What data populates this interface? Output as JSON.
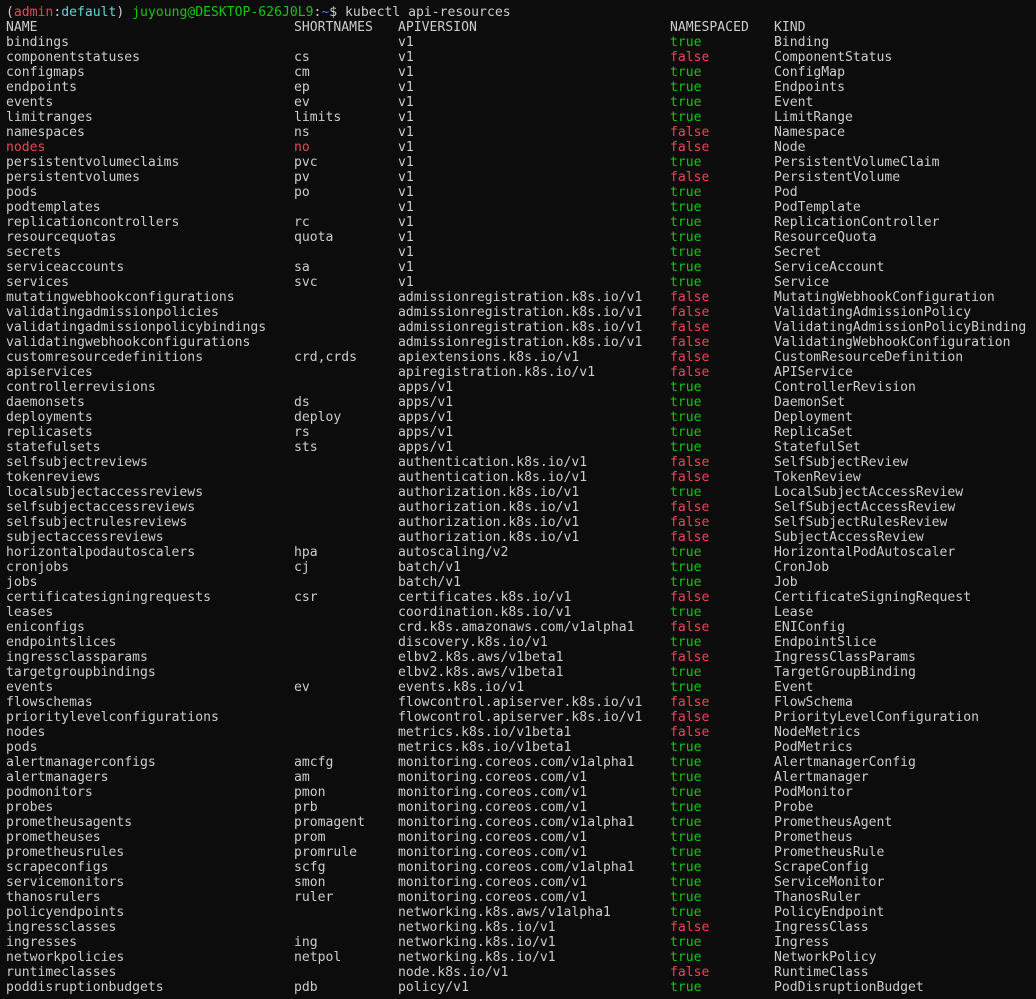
{
  "prompt": {
    "open_paren": "(",
    "env": "admin",
    "colon": ":",
    "context": "default",
    "close_paren": ")",
    "user_host": "juyoung@DESKTOP-626J0L9",
    "sep": ":",
    "path": "~",
    "dollar": "$",
    "command": "kubectl api-resources"
  },
  "headers": {
    "name": "NAME",
    "shortnames": "SHORTNAMES",
    "apiversion": "APIVERSION",
    "namespaced": "NAMESPACED",
    "kind": "KIND"
  },
  "rows": [
    {
      "name": "bindings",
      "short": "",
      "api": "v1",
      "ns": "true",
      "kind": "Binding"
    },
    {
      "name": "componentstatuses",
      "short": "cs",
      "api": "v1",
      "ns": "false",
      "kind": "ComponentStatus"
    },
    {
      "name": "configmaps",
      "short": "cm",
      "api": "v1",
      "ns": "true",
      "kind": "ConfigMap"
    },
    {
      "name": "endpoints",
      "short": "ep",
      "api": "v1",
      "ns": "true",
      "kind": "Endpoints"
    },
    {
      "name": "events",
      "short": "ev",
      "api": "v1",
      "ns": "true",
      "kind": "Event"
    },
    {
      "name": "limitranges",
      "short": "limits",
      "api": "v1",
      "ns": "true",
      "kind": "LimitRange"
    },
    {
      "name": "namespaces",
      "short": "ns",
      "api": "v1",
      "ns": "false",
      "kind": "Namespace"
    },
    {
      "name": "nodes",
      "short": "no",
      "api": "v1",
      "ns": "false",
      "kind": "Node",
      "highlight": true
    },
    {
      "name": "persistentvolumeclaims",
      "short": "pvc",
      "api": "v1",
      "ns": "true",
      "kind": "PersistentVolumeClaim"
    },
    {
      "name": "persistentvolumes",
      "short": "pv",
      "api": "v1",
      "ns": "false",
      "kind": "PersistentVolume"
    },
    {
      "name": "pods",
      "short": "po",
      "api": "v1",
      "ns": "true",
      "kind": "Pod"
    },
    {
      "name": "podtemplates",
      "short": "",
      "api": "v1",
      "ns": "true",
      "kind": "PodTemplate"
    },
    {
      "name": "replicationcontrollers",
      "short": "rc",
      "api": "v1",
      "ns": "true",
      "kind": "ReplicationController"
    },
    {
      "name": "resourcequotas",
      "short": "quota",
      "api": "v1",
      "ns": "true",
      "kind": "ResourceQuota"
    },
    {
      "name": "secrets",
      "short": "",
      "api": "v1",
      "ns": "true",
      "kind": "Secret"
    },
    {
      "name": "serviceaccounts",
      "short": "sa",
      "api": "v1",
      "ns": "true",
      "kind": "ServiceAccount"
    },
    {
      "name": "services",
      "short": "svc",
      "api": "v1",
      "ns": "true",
      "kind": "Service"
    },
    {
      "name": "mutatingwebhookconfigurations",
      "short": "",
      "api": "admissionregistration.k8s.io/v1",
      "ns": "false",
      "kind": "MutatingWebhookConfiguration"
    },
    {
      "name": "validatingadmissionpolicies",
      "short": "",
      "api": "admissionregistration.k8s.io/v1",
      "ns": "false",
      "kind": "ValidatingAdmissionPolicy"
    },
    {
      "name": "validatingadmissionpolicybindings",
      "short": "",
      "api": "admissionregistration.k8s.io/v1",
      "ns": "false",
      "kind": "ValidatingAdmissionPolicyBinding"
    },
    {
      "name": "validatingwebhookconfigurations",
      "short": "",
      "api": "admissionregistration.k8s.io/v1",
      "ns": "false",
      "kind": "ValidatingWebhookConfiguration"
    },
    {
      "name": "customresourcedefinitions",
      "short": "crd,crds",
      "api": "apiextensions.k8s.io/v1",
      "ns": "false",
      "kind": "CustomResourceDefinition"
    },
    {
      "name": "apiservices",
      "short": "",
      "api": "apiregistration.k8s.io/v1",
      "ns": "false",
      "kind": "APIService"
    },
    {
      "name": "controllerrevisions",
      "short": "",
      "api": "apps/v1",
      "ns": "true",
      "kind": "ControllerRevision"
    },
    {
      "name": "daemonsets",
      "short": "ds",
      "api": "apps/v1",
      "ns": "true",
      "kind": "DaemonSet"
    },
    {
      "name": "deployments",
      "short": "deploy",
      "api": "apps/v1",
      "ns": "true",
      "kind": "Deployment"
    },
    {
      "name": "replicasets",
      "short": "rs",
      "api": "apps/v1",
      "ns": "true",
      "kind": "ReplicaSet"
    },
    {
      "name": "statefulsets",
      "short": "sts",
      "api": "apps/v1",
      "ns": "true",
      "kind": "StatefulSet"
    },
    {
      "name": "selfsubjectreviews",
      "short": "",
      "api": "authentication.k8s.io/v1",
      "ns": "false",
      "kind": "SelfSubjectReview"
    },
    {
      "name": "tokenreviews",
      "short": "",
      "api": "authentication.k8s.io/v1",
      "ns": "false",
      "kind": "TokenReview"
    },
    {
      "name": "localsubjectaccessreviews",
      "short": "",
      "api": "authorization.k8s.io/v1",
      "ns": "true",
      "kind": "LocalSubjectAccessReview"
    },
    {
      "name": "selfsubjectaccessreviews",
      "short": "",
      "api": "authorization.k8s.io/v1",
      "ns": "false",
      "kind": "SelfSubjectAccessReview"
    },
    {
      "name": "selfsubjectrulesreviews",
      "short": "",
      "api": "authorization.k8s.io/v1",
      "ns": "false",
      "kind": "SelfSubjectRulesReview"
    },
    {
      "name": "subjectaccessreviews",
      "short": "",
      "api": "authorization.k8s.io/v1",
      "ns": "false",
      "kind": "SubjectAccessReview"
    },
    {
      "name": "horizontalpodautoscalers",
      "short": "hpa",
      "api": "autoscaling/v2",
      "ns": "true",
      "kind": "HorizontalPodAutoscaler"
    },
    {
      "name": "cronjobs",
      "short": "cj",
      "api": "batch/v1",
      "ns": "true",
      "kind": "CronJob"
    },
    {
      "name": "jobs",
      "short": "",
      "api": "batch/v1",
      "ns": "true",
      "kind": "Job"
    },
    {
      "name": "certificatesigningrequests",
      "short": "csr",
      "api": "certificates.k8s.io/v1",
      "ns": "false",
      "kind": "CertificateSigningRequest"
    },
    {
      "name": "leases",
      "short": "",
      "api": "coordination.k8s.io/v1",
      "ns": "true",
      "kind": "Lease"
    },
    {
      "name": "eniconfigs",
      "short": "",
      "api": "crd.k8s.amazonaws.com/v1alpha1",
      "ns": "false",
      "kind": "ENIConfig"
    },
    {
      "name": "endpointslices",
      "short": "",
      "api": "discovery.k8s.io/v1",
      "ns": "true",
      "kind": "EndpointSlice"
    },
    {
      "name": "ingressclassparams",
      "short": "",
      "api": "elbv2.k8s.aws/v1beta1",
      "ns": "false",
      "kind": "IngressClassParams"
    },
    {
      "name": "targetgroupbindings",
      "short": "",
      "api": "elbv2.k8s.aws/v1beta1",
      "ns": "true",
      "kind": "TargetGroupBinding"
    },
    {
      "name": "events",
      "short": "ev",
      "api": "events.k8s.io/v1",
      "ns": "true",
      "kind": "Event"
    },
    {
      "name": "flowschemas",
      "short": "",
      "api": "flowcontrol.apiserver.k8s.io/v1",
      "ns": "false",
      "kind": "FlowSchema"
    },
    {
      "name": "prioritylevelconfigurations",
      "short": "",
      "api": "flowcontrol.apiserver.k8s.io/v1",
      "ns": "false",
      "kind": "PriorityLevelConfiguration"
    },
    {
      "name": "nodes",
      "short": "",
      "api": "metrics.k8s.io/v1beta1",
      "ns": "false",
      "kind": "NodeMetrics"
    },
    {
      "name": "pods",
      "short": "",
      "api": "metrics.k8s.io/v1beta1",
      "ns": "true",
      "kind": "PodMetrics"
    },
    {
      "name": "alertmanagerconfigs",
      "short": "amcfg",
      "api": "monitoring.coreos.com/v1alpha1",
      "ns": "true",
      "kind": "AlertmanagerConfig"
    },
    {
      "name": "alertmanagers",
      "short": "am",
      "api": "monitoring.coreos.com/v1",
      "ns": "true",
      "kind": "Alertmanager"
    },
    {
      "name": "podmonitors",
      "short": "pmon",
      "api": "monitoring.coreos.com/v1",
      "ns": "true",
      "kind": "PodMonitor"
    },
    {
      "name": "probes",
      "short": "prb",
      "api": "monitoring.coreos.com/v1",
      "ns": "true",
      "kind": "Probe"
    },
    {
      "name": "prometheusagents",
      "short": "promagent",
      "api": "monitoring.coreos.com/v1alpha1",
      "ns": "true",
      "kind": "PrometheusAgent"
    },
    {
      "name": "prometheuses",
      "short": "prom",
      "api": "monitoring.coreos.com/v1",
      "ns": "true",
      "kind": "Prometheus"
    },
    {
      "name": "prometheusrules",
      "short": "promrule",
      "api": "monitoring.coreos.com/v1",
      "ns": "true",
      "kind": "PrometheusRule"
    },
    {
      "name": "scrapeconfigs",
      "short": "scfg",
      "api": "monitoring.coreos.com/v1alpha1",
      "ns": "true",
      "kind": "ScrapeConfig"
    },
    {
      "name": "servicemonitors",
      "short": "smon",
      "api": "monitoring.coreos.com/v1",
      "ns": "true",
      "kind": "ServiceMonitor"
    },
    {
      "name": "thanosrulers",
      "short": "ruler",
      "api": "monitoring.coreos.com/v1",
      "ns": "true",
      "kind": "ThanosRuler"
    },
    {
      "name": "policyendpoints",
      "short": "",
      "api": "networking.k8s.aws/v1alpha1",
      "ns": "true",
      "kind": "PolicyEndpoint"
    },
    {
      "name": "ingressclasses",
      "short": "",
      "api": "networking.k8s.io/v1",
      "ns": "false",
      "kind": "IngressClass"
    },
    {
      "name": "ingresses",
      "short": "ing",
      "api": "networking.k8s.io/v1",
      "ns": "true",
      "kind": "Ingress"
    },
    {
      "name": "networkpolicies",
      "short": "netpol",
      "api": "networking.k8s.io/v1",
      "ns": "true",
      "kind": "NetworkPolicy"
    },
    {
      "name": "runtimeclasses",
      "short": "",
      "api": "node.k8s.io/v1",
      "ns": "false",
      "kind": "RuntimeClass"
    },
    {
      "name": "poddisruptionbudgets",
      "short": "pdb",
      "api": "policy/v1",
      "ns": "true",
      "kind": "PodDisruptionBudget"
    }
  ],
  "colors": {
    "background": "#0c0c0c",
    "foreground": "#cccccc",
    "true": "#16c60c",
    "false": "#e74856",
    "prompt_user": "#16c60c",
    "prompt_path": "#3b78ff",
    "prompt_env": "#e74856",
    "prompt_context": "#61d6d6"
  }
}
